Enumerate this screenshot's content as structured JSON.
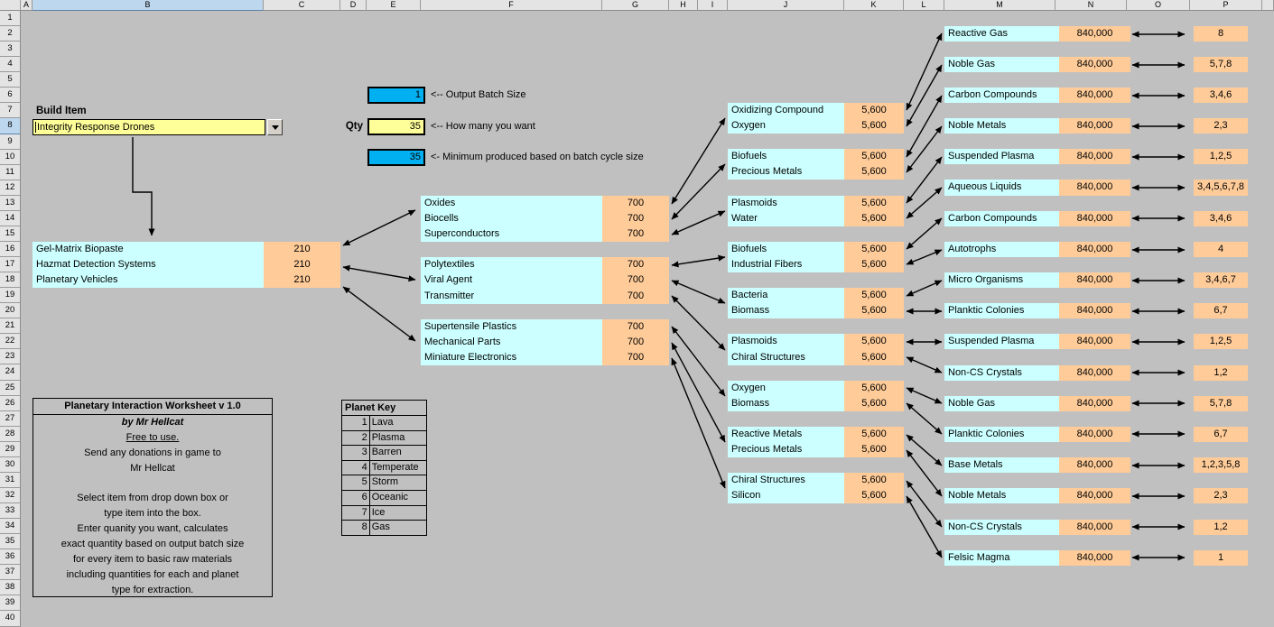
{
  "columns": [
    "A",
    "B",
    "C",
    "D",
    "E",
    "F",
    "G",
    "H",
    "I",
    "J",
    "K",
    "L",
    "M",
    "N",
    "O",
    "P"
  ],
  "rows": [
    "1",
    "2",
    "3",
    "4",
    "5",
    "6",
    "7",
    "8",
    "9",
    "10",
    "11",
    "12",
    "13",
    "14",
    "15",
    "16",
    "17",
    "18",
    "19",
    "20",
    "21",
    "22",
    "23",
    "24",
    "25",
    "26",
    "27",
    "28",
    "29",
    "30",
    "31",
    "32",
    "33",
    "34",
    "35",
    "36",
    "37",
    "38",
    "39",
    "40"
  ],
  "build": {
    "label": "Build Item",
    "item": "Integrity Response Drones",
    "qty_label": "Qty",
    "batch_value": "1",
    "batch_note": "<-- Output Batch Size",
    "qty_value": "35",
    "qty_note": "<-- How many you want",
    "min_value": "35",
    "min_note": "<- Minimum produced based on batch cycle size"
  },
  "tier1": {
    "items": [
      "Gel-Matrix Biopaste",
      "Hazmat Detection Systems",
      "Planetary Vehicles"
    ],
    "quantities": [
      "210",
      "210",
      "210"
    ]
  },
  "tier2": [
    {
      "items": [
        "Oxides",
        "Biocells",
        "Superconductors"
      ],
      "qty": [
        "700",
        "700",
        "700"
      ]
    },
    {
      "items": [
        "Polytextiles",
        "Viral Agent",
        "Transmitter"
      ],
      "qty": [
        "700",
        "700",
        "700"
      ]
    },
    {
      "items": [
        "Supertensile Plastics",
        "Mechanical Parts",
        "Miniature Electronics"
      ],
      "qty": [
        "700",
        "700",
        "700"
      ]
    }
  ],
  "tier3": [
    {
      "a": "Oxidizing Compound",
      "b": "Oxygen",
      "qty_a": "5,600",
      "qty_b": "5,600"
    },
    {
      "a": "Biofuels",
      "b": "Precious Metals",
      "qty_a": "5,600",
      "qty_b": "5,600"
    },
    {
      "a": "Plasmoids",
      "b": "Water",
      "qty_a": "5,600",
      "qty_b": "5,600"
    },
    {
      "a": "Biofuels",
      "b": "Industrial Fibers",
      "qty_a": "5,600",
      "qty_b": "5,600"
    },
    {
      "a": "Bacteria",
      "b": "Biomass",
      "qty_a": "5,600",
      "qty_b": "5,600"
    },
    {
      "a": "Plasmoids",
      "b": "Chiral Structures",
      "qty_a": "5,600",
      "qty_b": "5,600"
    },
    {
      "a": "Oxygen",
      "b": "Biomass",
      "qty_a": "5,600",
      "qty_b": "5,600"
    },
    {
      "a": "Reactive Metals",
      "b": "Precious Metals",
      "qty_a": "5,600",
      "qty_b": "5,600"
    },
    {
      "a": "Chiral Structures",
      "b": "Silicon",
      "qty_a": "5,600",
      "qty_b": "5,600"
    }
  ],
  "tier4": [
    {
      "name": "Reactive Gas",
      "qty": "840,000",
      "planets": "8"
    },
    {
      "name": "Noble Gas",
      "qty": "840,000",
      "planets": "5,7,8"
    },
    {
      "name": "Carbon Compounds",
      "qty": "840,000",
      "planets": "3,4,6"
    },
    {
      "name": "Noble Metals",
      "qty": "840,000",
      "planets": "2,3"
    },
    {
      "name": "Suspended Plasma",
      "qty": "840,000",
      "planets": "1,2,5"
    },
    {
      "name": "Aqueous Liquids",
      "qty": "840,000",
      "planets": "3,4,5,6,7,8"
    },
    {
      "name": "Carbon Compounds",
      "qty": "840,000",
      "planets": "3,4,6"
    },
    {
      "name": "Autotrophs",
      "qty": "840,000",
      "planets": "4"
    },
    {
      "name": "Micro Organisms",
      "qty": "840,000",
      "planets": "3,4,6,7"
    },
    {
      "name": "Planktic Colonies",
      "qty": "840,000",
      "planets": "6,7"
    },
    {
      "name": "Suspended Plasma",
      "qty": "840,000",
      "planets": "1,2,5"
    },
    {
      "name": "Non-CS Crystals",
      "qty": "840,000",
      "planets": "1,2"
    },
    {
      "name": "Noble Gas",
      "qty": "840,000",
      "planets": "5,7,8"
    },
    {
      "name": "Planktic Colonies",
      "qty": "840,000",
      "planets": "6,7"
    },
    {
      "name": "Base Metals",
      "qty": "840,000",
      "planets": "1,2,3,5,8"
    },
    {
      "name": "Noble Metals",
      "qty": "840,000",
      "planets": "2,3"
    },
    {
      "name": "Non-CS Crystals",
      "qty": "840,000",
      "planets": "1,2"
    },
    {
      "name": "Felsic Magma",
      "qty": "840,000",
      "planets": "1"
    }
  ],
  "info_box": {
    "title": "Planetary Interaction Worksheet v 1.0",
    "lines": [
      "by Mr Hellcat",
      "Free to use.",
      "Send any donations in game to",
      "Mr Hellcat",
      "",
      "Select item from drop down box or",
      "type item into the box.",
      "Enter quanity you want, calculates",
      "exact quantity based on output batch size",
      "for every item to basic raw materials",
      "including quantities for each and planet",
      "type for extraction."
    ]
  },
  "planet_key": {
    "title": "Planet Key",
    "entries": [
      {
        "num": "1",
        "name": "Lava"
      },
      {
        "num": "2",
        "name": "Plasma"
      },
      {
        "num": "3",
        "name": "Barren"
      },
      {
        "num": "4",
        "name": "Temperate"
      },
      {
        "num": "5",
        "name": "Storm"
      },
      {
        "num": "6",
        "name": "Oceanic"
      },
      {
        "num": "7",
        "name": "Ice"
      },
      {
        "num": "8",
        "name": "Gas"
      }
    ]
  },
  "colors": {
    "sheet_background": "#C0C0C0",
    "item_cell": "#CCFFFF",
    "quantity_cell": "#FFCC99",
    "input_yellow": "#FFFF99",
    "calculated_blue": "#00B0F0",
    "selected_header": "#BDD7EE"
  }
}
